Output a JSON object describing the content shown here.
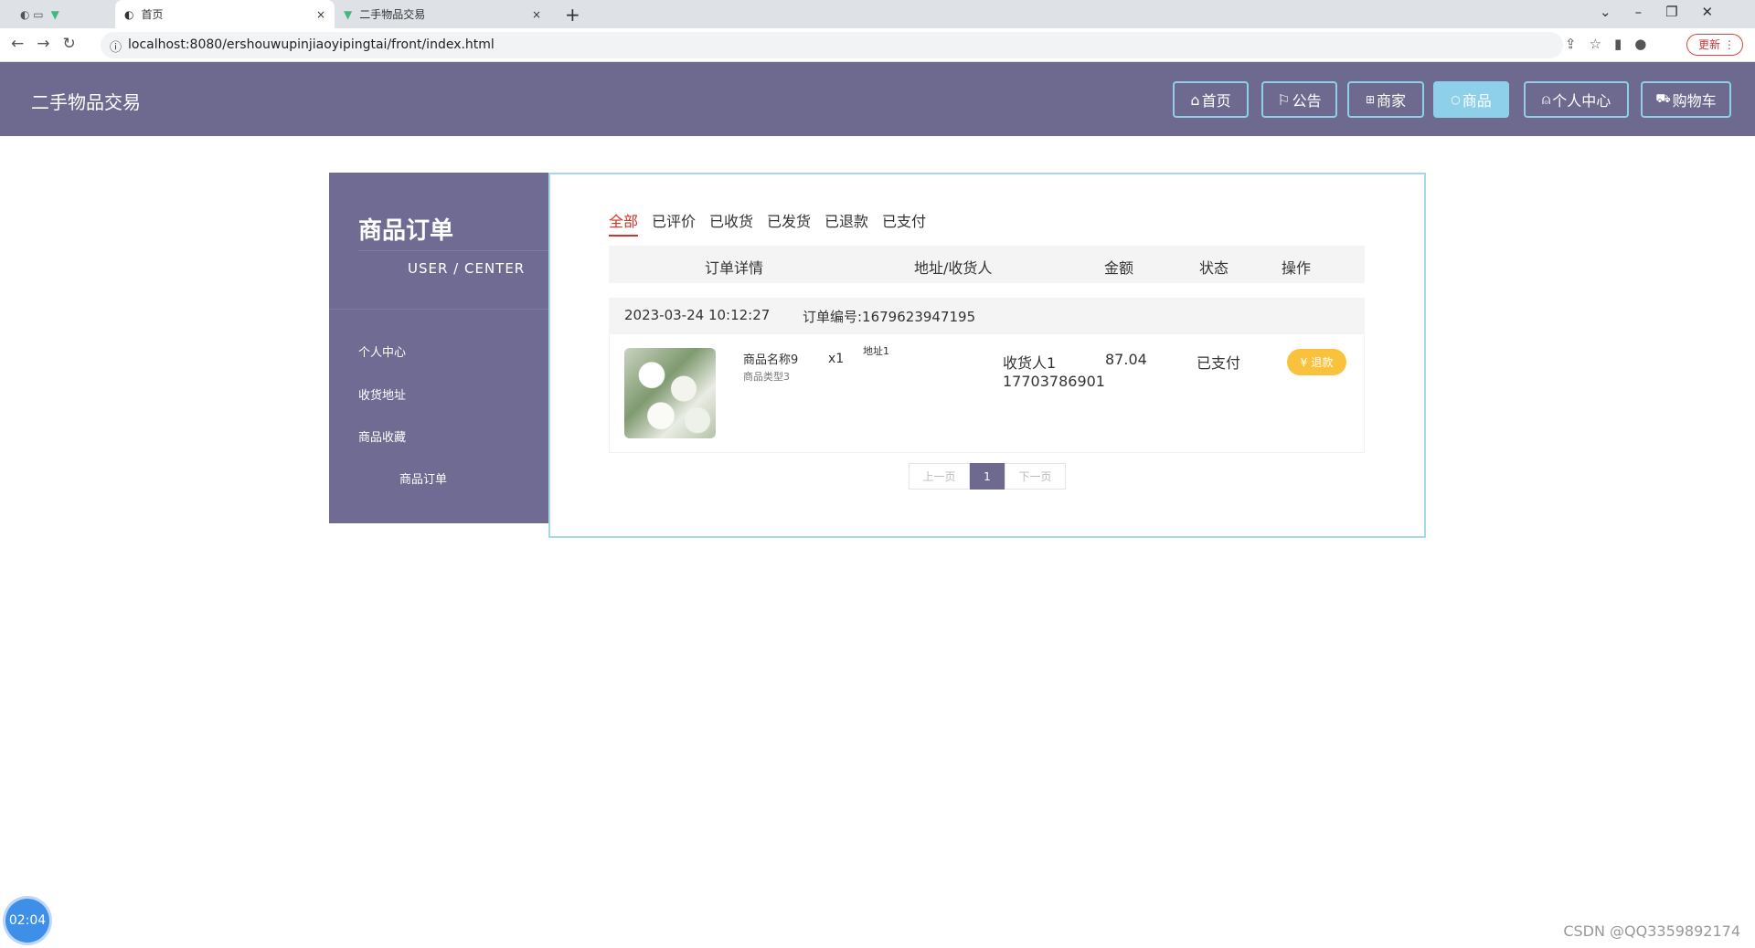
{
  "browser": {
    "tabs": [
      {
        "title": "首页",
        "icon": "globe-icon"
      },
      {
        "title": "二手物品交易",
        "icon": "vue-icon"
      }
    ],
    "url": "localhost:8080/ershouwupinjiaoyipingtai/front/index.html",
    "update_label": "更新"
  },
  "header": {
    "site_title": "二手物品交易",
    "nav": [
      {
        "label": "首页",
        "icon": "home-icon"
      },
      {
        "label": "公告",
        "icon": "flag-icon"
      },
      {
        "label": "商家",
        "icon": "gift-icon"
      },
      {
        "label": "商品",
        "icon": "goods-icon",
        "active": true
      },
      {
        "label": "个人中心",
        "icon": "user-icon"
      },
      {
        "label": "购物车",
        "icon": "cart-icon"
      }
    ]
  },
  "sidebar": {
    "title": "商品订单",
    "subtitle": "USER / CENTER",
    "items": [
      {
        "label": "个人中心"
      },
      {
        "label": "收货地址"
      },
      {
        "label": "商品收藏"
      },
      {
        "label": "商品订单",
        "active": true
      }
    ]
  },
  "orders": {
    "tabs": [
      {
        "label": "全部",
        "active": true
      },
      {
        "label": "已评价"
      },
      {
        "label": "已收货"
      },
      {
        "label": "已发货"
      },
      {
        "label": "已退款"
      },
      {
        "label": "已支付"
      }
    ],
    "columns": [
      "订单详情",
      "地址/收货人",
      "金额",
      "状态",
      "操作"
    ],
    "list": [
      {
        "time": "2023-03-24 10:12:27",
        "order_no": "订单编号:1679623947195",
        "goods_name": "商品名称9",
        "goods_type": "商品类型3",
        "quantity": "x1",
        "address": "地址1",
        "receiver": "收货人1",
        "phone": "17703786901",
        "amount": "87.04",
        "status": "已支付",
        "action": "退款"
      }
    ],
    "pagination": {
      "prev": "上一页",
      "current": "1",
      "next": "下一页"
    }
  },
  "timer": "02:04",
  "watermark": "CSDN @QQ3359892174",
  "colors": {
    "header": "#6e6a8f",
    "accent": "#8ecfea",
    "active_tab": "#d0342c",
    "refund": "#f9c23c"
  }
}
